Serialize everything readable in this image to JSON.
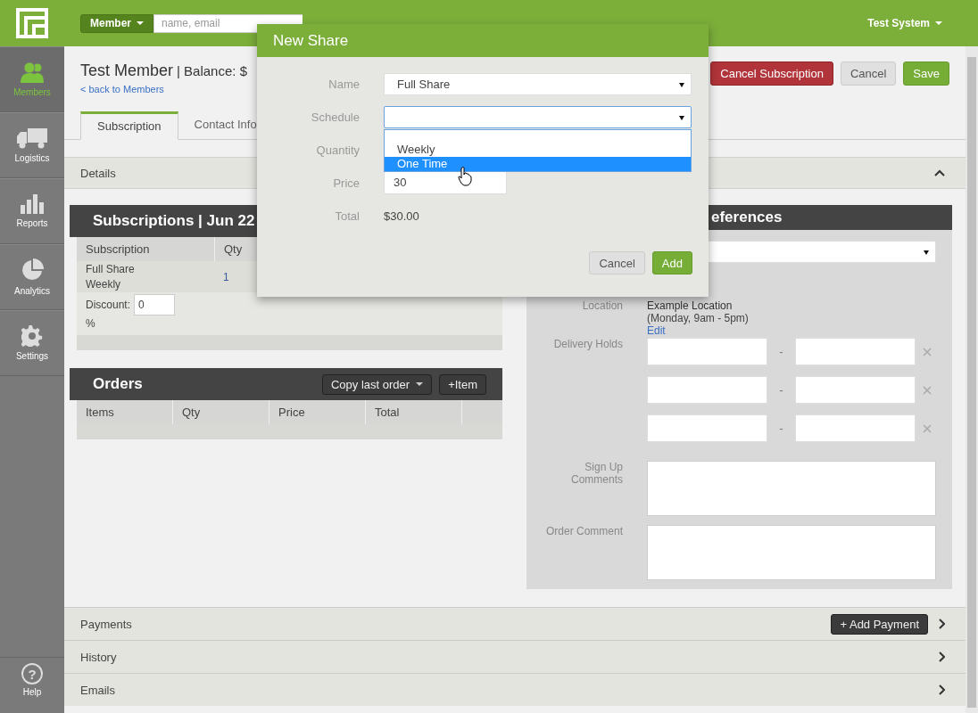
{
  "top_bar": {
    "search_scope": "Member",
    "search": {
      "placeholder": "name, email"
    },
    "user_menu": "Test System"
  },
  "sidebar": {
    "items": [
      {
        "label": "Members",
        "kind": "people",
        "selected": true
      },
      {
        "label": "Logistics",
        "kind": "truck",
        "selected": false
      },
      {
        "label": "Reports",
        "kind": "bars",
        "selected": false
      },
      {
        "label": "Analytics",
        "kind": "pie",
        "selected": false
      },
      {
        "label": "Settings",
        "kind": "gear",
        "selected": false
      }
    ],
    "help": {
      "icon": "?",
      "label": "Help"
    }
  },
  "header": {
    "title": "Test Member",
    "balance": "| Balance: $",
    "back_link": "< back to Members",
    "buttons": [
      {
        "label": "Cancel Subscription",
        "kind": "danger"
      },
      {
        "label": "Cancel",
        "kind": "default"
      },
      {
        "label": "Save",
        "kind": "primary"
      }
    ]
  },
  "tabs": [
    {
      "label": "Subscription",
      "selected": true
    },
    {
      "label": "Contact Info",
      "selected": false
    }
  ],
  "details": {
    "title": "Details",
    "expanded": true
  },
  "subscriptions": {
    "title": "Subscriptions | Jun 22",
    "columns": [
      "Subscription",
      "Qty"
    ],
    "rows": [
      {
        "name": "Full Share",
        "schedule": "Weekly",
        "qty": "1"
      }
    ],
    "discount_label": "Discount:",
    "discount_value": "0",
    "percent": "%"
  },
  "orders": {
    "title": "Orders",
    "copy_button": "Copy last order",
    "item_button": "+Item",
    "columns": [
      "Items",
      "Qty",
      "Price",
      "Total"
    ]
  },
  "preferences": {
    "title": "eferences",
    "location_label": "Location",
    "location_name": "Example Location",
    "location_hours": "(Monday, 9am - 5pm)",
    "edit_link": "Edit",
    "holds_label": "Delivery Holds",
    "holds": [
      {
        "separator": "-"
      },
      {
        "separator": "-"
      },
      {
        "separator": "-"
      }
    ],
    "signup_label": "Sign Up Comments",
    "order_comment_label": "Order Comment"
  },
  "sections": [
    {
      "title": "Payments",
      "expanded": false,
      "button": "+ Add Payment"
    },
    {
      "title": "History",
      "expanded": false
    },
    {
      "title": "Emails",
      "expanded": false
    }
  ],
  "modal": {
    "title": "New Share",
    "fields": [
      {
        "label": "Name",
        "kind": "select",
        "value": "Full Share"
      },
      {
        "label": "Schedule",
        "kind": "select",
        "options": [
          {
            "label": "Weekly",
            "selected": false
          },
          {
            "label": "One Time",
            "selected": true
          }
        ]
      },
      {
        "label": "Quantity",
        "kind": "input"
      },
      {
        "label": "Price",
        "kind": "input",
        "value": "30"
      },
      {
        "label": "Total",
        "kind": "text",
        "value": "$30.00"
      }
    ],
    "buttons": [
      {
        "label": "Cancel",
        "kind": "default"
      },
      {
        "label": "Add",
        "kind": "primary"
      }
    ]
  }
}
